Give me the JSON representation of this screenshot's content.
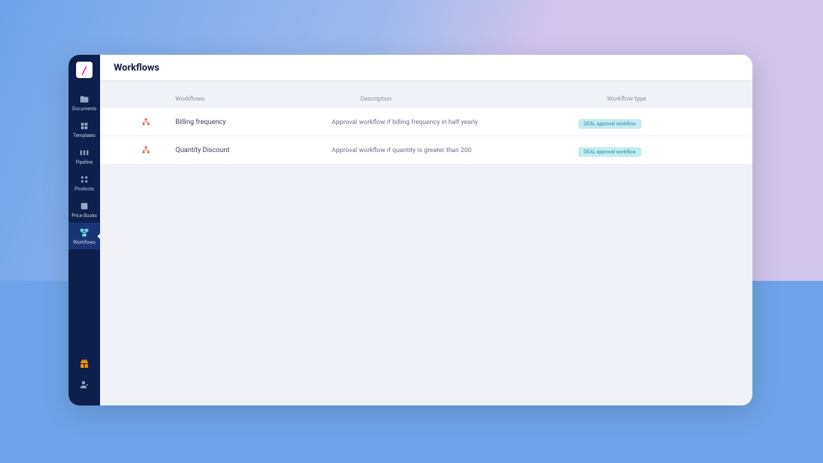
{
  "header": {
    "title": "Workflows"
  },
  "sidebar": {
    "logo": "/",
    "items": [
      {
        "label": "Documents"
      },
      {
        "label": "Templates"
      },
      {
        "label": "Pipeline"
      },
      {
        "label": "Products"
      },
      {
        "label": "Price Books"
      },
      {
        "label": "Workflows"
      }
    ]
  },
  "table": {
    "columns": {
      "workflows": "Workflows",
      "description": "Description",
      "workflow_type": "Workflow type"
    },
    "rows": [
      {
        "name": "Billing frequency",
        "description": "Approval workflow if billing frequency in half yearly",
        "type": "DEAL approval workflow"
      },
      {
        "name": "Quantity Discount",
        "description": "Approval workflow if quantity is greater than 200",
        "type": "DEAL approval workflow"
      }
    ]
  }
}
